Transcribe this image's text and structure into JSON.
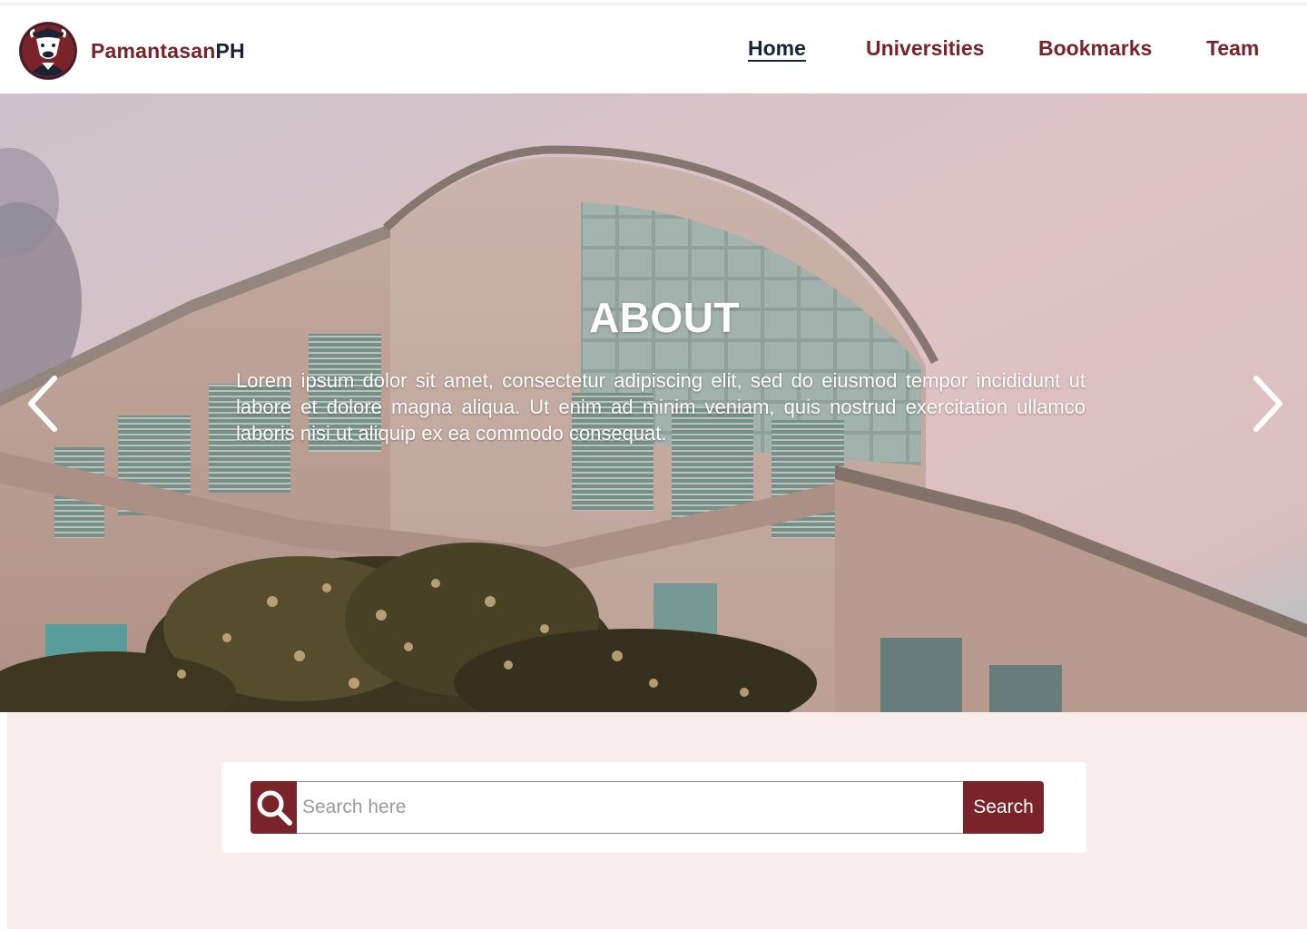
{
  "brand": {
    "name_part1": "Pamantasan",
    "name_part2": "PH"
  },
  "nav": {
    "items": [
      {
        "label": "Home",
        "active": true
      },
      {
        "label": "Universities",
        "active": false
      },
      {
        "label": "Bookmarks",
        "active": false
      },
      {
        "label": "Team",
        "active": false
      }
    ]
  },
  "hero": {
    "title": "ABOUT",
    "text": "Lorem ipsum dolor sit amet, consectetur adipiscing elit, sed do eiusmod tempor incididunt ut labore et dolore magna aliqua. Ut enim ad minim veniam, quis nostrud exercitation ullamco laboris nisi ut aliquip ex ea commodo consequat."
  },
  "search": {
    "placeholder": "Search here",
    "button_label": "Search"
  },
  "colors": {
    "accent": "#7a2328",
    "nav_active": "#16253a",
    "section_bg": "#f9ecec"
  }
}
